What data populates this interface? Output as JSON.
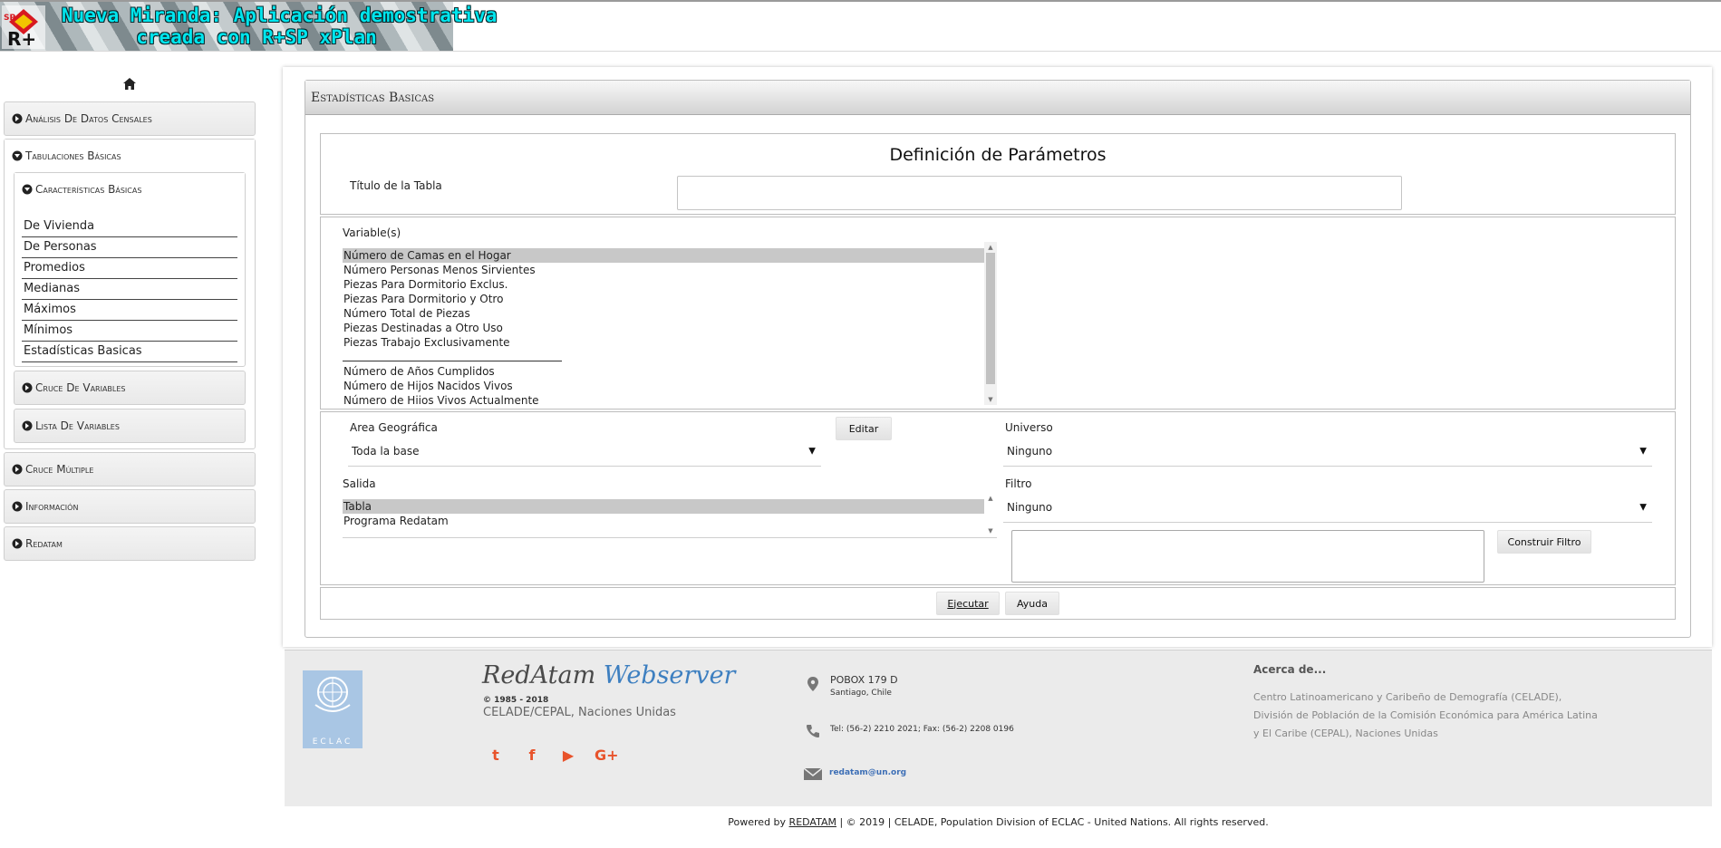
{
  "header": {
    "logo_text": "SP R+",
    "title_line1": "Nueva Miranda: Aplicación demostrativa",
    "title_line2": "creada con R+SP xPlan"
  },
  "sidebar": {
    "home_icon": "home-icon",
    "sections": [
      "Análisis De Datos Censales",
      "Tabulaciones Básicas",
      "Cruce Múltiple",
      "Información",
      "Redatam"
    ],
    "subsections": [
      "Características Básicas",
      "Cruce De Variables",
      "Lista De Variables"
    ],
    "links": [
      "De Vivienda",
      "De Personas",
      "Promedios",
      "Medianas",
      "Máximos",
      "Mínimos",
      "Estadísticas Basicas"
    ]
  },
  "panel": {
    "title": "Estadísticas Basicas",
    "params_title": "Definición de Parámetros",
    "table_title_label": "Título de la Tabla",
    "table_title_value": "",
    "variables_label": "Variable(s)",
    "variables": [
      "Número de Camas en el Hogar",
      "Número Personas Menos Sirvientes",
      "Piezas Para Dormitorio Exclus.",
      "Piezas Para Dormitorio y Otro",
      "Número Total de Piezas",
      "Piezas Destinadas a Otro Uso",
      "Piezas Trabajo Exclusivamente",
      "Número de Años Cumplidos",
      "Número de Hijos Nacidos Vivos",
      "Número de Hijos Vivos Actualmente"
    ],
    "area_label": "Area Geográfica",
    "area_value": "Toda la base",
    "edit_button": "Editar",
    "universe_label": "Universo",
    "universe_value": "Ninguno",
    "output_label": "Salida",
    "output_options": [
      "Tabla",
      "Programa Redatam"
    ],
    "filter_label": "Filtro",
    "filter_value": "Ninguno",
    "filter_text": "",
    "build_filter_button": "Construir Filtro",
    "run_button": "Ejecutar",
    "help_button": "Ayuda"
  },
  "footer": {
    "brand_part1": "RedAtam",
    "brand_part2": "Webserver",
    "copyright": "© 1985 - 2018",
    "org": "CELADE/CEPAL, Naciones Unidas",
    "un_logo_text": "ECLAC",
    "social": [
      "twitter-icon",
      "facebook-icon",
      "youtube-icon",
      "google-plus-icon"
    ],
    "address_line1": "POBOX 179 D",
    "address_line2": "Santiago, Chile",
    "phone": "Tel: (56-2) 2210 2021; Fax: (56-2) 2208 0196",
    "email": "redatam@un.org",
    "about_title": "Acerca de...",
    "about_text": "Centro Latinoamericano y Caribeño de Demografía (CELADE), División de Población de la Comisión Económica para América Latina y El Caribe (CEPAL), Naciones Unidas",
    "powered_prefix": "Powered by",
    "powered_link": "REDATAM",
    "powered_suffix": "| © 2019 | CELADE, Population Division of ECLAC - United Nations. All rights reserved."
  }
}
